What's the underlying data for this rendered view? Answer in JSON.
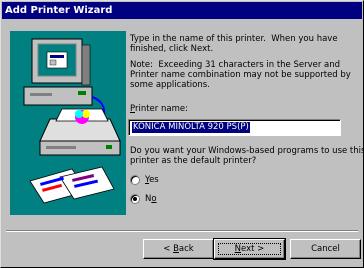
{
  "window": {
    "title": "Add Printer Wizard"
  },
  "instructions": {
    "line1": "Type in the name of this printer.  When you have",
    "line2": "finished, click Next.",
    "note1": "Note:  Exceeding 31 characters in the Server and",
    "note2": "Printer name combination may not be supported by",
    "note3": "some applications."
  },
  "printer_name": {
    "label_accel": "P",
    "label_rest": "rinter name:",
    "value": "KONICA MINOLTA 920 PS(P)"
  },
  "default_question": {
    "line1": "Do you want your Windows-based programs to use this",
    "line2": "printer as the default printer?"
  },
  "options": [
    {
      "accel": "Y",
      "rest": "es",
      "selected": false
    },
    {
      "accel": "o",
      "prefix": "N",
      "selected": true
    }
  ],
  "buttons": {
    "back_prefix": "< ",
    "back_accel": "B",
    "back_rest": "ack",
    "next_accel": "N",
    "next_rest": "ext >",
    "cancel": "Cancel"
  }
}
